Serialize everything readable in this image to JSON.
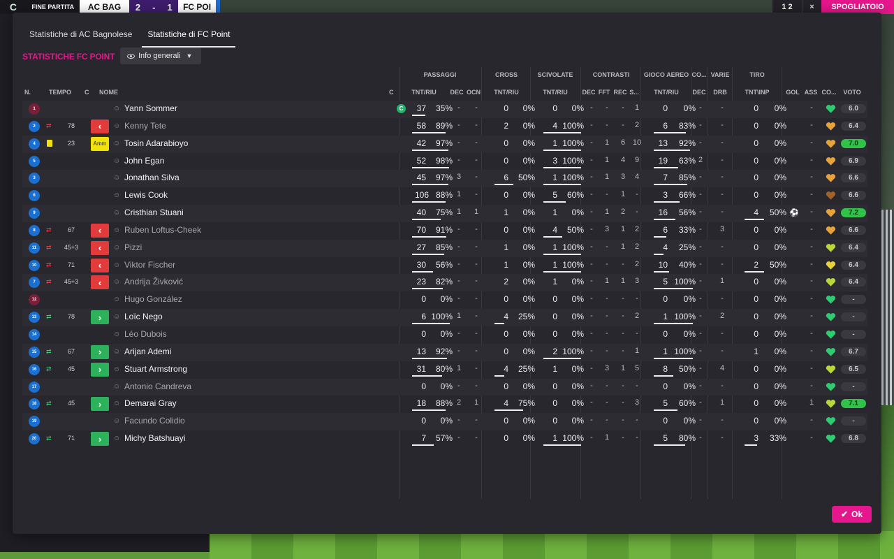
{
  "scorebar": {
    "status": "FINE PARTITA",
    "home": "AC BAG",
    "score_home": "2",
    "score_sep": "-",
    "score_away": "1",
    "away": "FC POI",
    "logo": "C"
  },
  "top_right": {
    "counter": "1 2",
    "close": "×",
    "button": "SPOGLIATOIO"
  },
  "tabs": [
    "Statistiche di AC Bagnolese",
    "Statistiche di FC Point"
  ],
  "section_title": "STATISTICHE FC POINT",
  "dropdown": "Info generali",
  "groups": {
    "passaggi": "PASSAGGI",
    "cross": "CROSS",
    "scivolate": "SCIVOLATE",
    "contrasti": "CONTRASTI",
    "gioco_aereo": "GIOCO AEREO",
    "co": "CO...",
    "varie": "VARIE",
    "tiro": "TIRO"
  },
  "columns": {
    "n": "N.",
    "tempo": "TEMPO",
    "c": "C",
    "nome": "NOME",
    "c2": "C",
    "pass_tnt": "TNT/RIU",
    "pass_dec": "DEC",
    "pass_ocn": "OCN",
    "cross_tnt": "TNT/RIU",
    "sciv_tnt": "TNT/RIU",
    "con_dec": "DEC",
    "con_fft": "FFT",
    "con_rec": "REC",
    "con_s": "S...",
    "aereo_tnt": "TNT/RIU",
    "co_dec": "DEC",
    "varie_drb": "DRB",
    "tiro_tnt": "TNT\\INP",
    "gol": "GOL",
    "ass": "ASS",
    "cond": "CO...",
    "voto": "VOTO"
  },
  "players": [
    {
      "num": "1",
      "gk": true,
      "ev": "",
      "time": "",
      "cap": "",
      "name": "Yann Sommer",
      "dim": false,
      "captain": true,
      "p": [
        "37",
        "35%"
      ],
      "pd": "-",
      "po": "-",
      "cr": [
        "0",
        "0%"
      ],
      "sc": [
        "0",
        "0%"
      ],
      "cd": "-",
      "cf": "-",
      "crc": "-",
      "cs": "1",
      "ae": [
        "0",
        "0%"
      ],
      "cod": "-",
      "drb": "-",
      "ti": [
        "0",
        "0%"
      ],
      "gol": "",
      "ass": "-",
      "heart": "#2ecc71",
      "voto": "6.0",
      "vg": false,
      "pb": 0.35,
      "crb": 0,
      "scb": 0,
      "aeb": 0,
      "tib": 0
    },
    {
      "num": "2",
      "gk": false,
      "ev": "out",
      "time": "78",
      "cap": "r",
      "name": "Kenny Tete",
      "dim": true,
      "captain": false,
      "p": [
        "58",
        "89%"
      ],
      "pd": "-",
      "po": "-",
      "cr": [
        "2",
        "0%"
      ],
      "sc": [
        "4",
        "100%"
      ],
      "cd": "-",
      "cf": "-",
      "crc": "-",
      "cs": "2",
      "ae": [
        "6",
        "83%"
      ],
      "cod": "-",
      "drb": "-",
      "ti": [
        "0",
        "0%"
      ],
      "gol": "",
      "ass": "-",
      "heart": "#e8a23a",
      "voto": "6.4",
      "vg": false,
      "pb": 0.89,
      "crb": 0,
      "scb": 1,
      "aeb": 0.83,
      "tib": 0
    },
    {
      "num": "4",
      "gk": false,
      "ev": "yc",
      "time": "23",
      "cap": "y",
      "name": "Tosin Adarabioyo",
      "dim": false,
      "captain": false,
      "p": [
        "42",
        "97%"
      ],
      "pd": "-",
      "po": "-",
      "cr": [
        "0",
        "0%"
      ],
      "sc": [
        "1",
        "100%"
      ],
      "cd": "-",
      "cf": "1",
      "crc": "6",
      "cs": "10",
      "ae": [
        "13",
        "92%"
      ],
      "cod": "-",
      "drb": "-",
      "ti": [
        "0",
        "0%"
      ],
      "gol": "",
      "ass": "-",
      "heart": "#e8a23a",
      "voto": "7.0",
      "vg": true,
      "pb": 0.97,
      "crb": 0,
      "scb": 1,
      "aeb": 0.92,
      "tib": 0
    },
    {
      "num": "5",
      "gk": false,
      "ev": "",
      "time": "",
      "cap": "",
      "name": "John Egan",
      "dim": false,
      "captain": false,
      "p": [
        "52",
        "98%"
      ],
      "pd": "-",
      "po": "-",
      "cr": [
        "0",
        "0%"
      ],
      "sc": [
        "3",
        "100%"
      ],
      "cd": "-",
      "cf": "1",
      "crc": "4",
      "cs": "9",
      "ae": [
        "19",
        "63%"
      ],
      "cod": "2",
      "drb": "-",
      "ti": [
        "0",
        "0%"
      ],
      "gol": "",
      "ass": "-",
      "heart": "#e8a23a",
      "voto": "6.9",
      "vg": false,
      "pb": 0.98,
      "crb": 0,
      "scb": 1,
      "aeb": 0.63,
      "tib": 0
    },
    {
      "num": "3",
      "gk": false,
      "ev": "",
      "time": "",
      "cap": "",
      "name": "Jonathan Silva",
      "dim": false,
      "captain": false,
      "p": [
        "45",
        "97%"
      ],
      "pd": "3",
      "po": "-",
      "cr": [
        "6",
        "50%"
      ],
      "sc": [
        "1",
        "100%"
      ],
      "cd": "-",
      "cf": "1",
      "crc": "3",
      "cs": "4",
      "ae": [
        "7",
        "85%"
      ],
      "cod": "-",
      "drb": "-",
      "ti": [
        "0",
        "0%"
      ],
      "gol": "",
      "ass": "-",
      "heart": "#e8a23a",
      "voto": "6.6",
      "vg": false,
      "pb": 0.97,
      "crb": 0.5,
      "scb": 1,
      "aeb": 0.85,
      "tib": 0
    },
    {
      "num": "6",
      "gk": false,
      "ev": "",
      "time": "",
      "cap": "",
      "name": "Lewis Cook",
      "dim": false,
      "captain": false,
      "p": [
        "106",
        "88%"
      ],
      "pd": "1",
      "po": "-",
      "cr": [
        "0",
        "0%"
      ],
      "sc": [
        "5",
        "60%"
      ],
      "cd": "-",
      "cf": "-",
      "crc": "1",
      "cs": "-",
      "ae": [
        "3",
        "66%"
      ],
      "cod": "-",
      "drb": "-",
      "ti": [
        "0",
        "0%"
      ],
      "gol": "",
      "ass": "-",
      "heart": "#a0622a",
      "voto": "6.6",
      "vg": false,
      "pb": 0.88,
      "crb": 0,
      "scb": 0.6,
      "aeb": 0.66,
      "tib": 0
    },
    {
      "num": "9",
      "gk": false,
      "ev": "",
      "time": "",
      "cap": "",
      "name": "Cristhian Stuani",
      "dim": false,
      "captain": false,
      "p": [
        "40",
        "75%"
      ],
      "pd": "1",
      "po": "1",
      "cr": [
        "1",
        "0%"
      ],
      "sc": [
        "1",
        "0%"
      ],
      "cd": "-",
      "cf": "1",
      "crc": "2",
      "cs": "-",
      "ae": [
        "16",
        "56%"
      ],
      "cod": "-",
      "drb": "-",
      "ti": [
        "4",
        "50%"
      ],
      "gol": "⚽",
      "ass": "-",
      "heart": "#e8a23a",
      "voto": "7.2",
      "vg": true,
      "pb": 0.75,
      "crb": 0,
      "scb": 0,
      "aeb": 0.56,
      "tib": 0.5
    },
    {
      "num": "8",
      "gk": false,
      "ev": "out",
      "time": "67",
      "cap": "r",
      "name": "Ruben Loftus-Cheek",
      "dim": true,
      "captain": false,
      "p": [
        "70",
        "91%"
      ],
      "pd": "-",
      "po": "-",
      "cr": [
        "0",
        "0%"
      ],
      "sc": [
        "4",
        "50%"
      ],
      "cd": "-",
      "cf": "3",
      "crc": "1",
      "cs": "2",
      "ae": [
        "6",
        "33%"
      ],
      "cod": "-",
      "drb": "3",
      "ti": [
        "0",
        "0%"
      ],
      "gol": "",
      "ass": "-",
      "heart": "#e8a23a",
      "voto": "6.6",
      "vg": false,
      "pb": 0.91,
      "crb": 0,
      "scb": 0.5,
      "aeb": 0.33,
      "tib": 0
    },
    {
      "num": "11",
      "gk": false,
      "ev": "out",
      "time": "45+3",
      "cap": "r",
      "name": "Pizzi",
      "dim": true,
      "captain": false,
      "p": [
        "27",
        "85%"
      ],
      "pd": "-",
      "po": "-",
      "cr": [
        "1",
        "0%"
      ],
      "sc": [
        "1",
        "100%"
      ],
      "cd": "-",
      "cf": "-",
      "crc": "1",
      "cs": "2",
      "ae": [
        "4",
        "25%"
      ],
      "cod": "-",
      "drb": "-",
      "ti": [
        "0",
        "0%"
      ],
      "gol": "",
      "ass": "-",
      "heart": "#b8d83a",
      "voto": "6.4",
      "vg": false,
      "pb": 0.85,
      "crb": 0,
      "scb": 1,
      "aeb": 0.25,
      "tib": 0
    },
    {
      "num": "10",
      "gk": false,
      "ev": "out",
      "time": "71",
      "cap": "r",
      "name": "Viktor Fischer",
      "dim": true,
      "captain": false,
      "p": [
        "30",
        "56%"
      ],
      "pd": "-",
      "po": "-",
      "cr": [
        "1",
        "0%"
      ],
      "sc": [
        "1",
        "100%"
      ],
      "cd": "-",
      "cf": "-",
      "crc": "-",
      "cs": "2",
      "ae": [
        "10",
        "40%"
      ],
      "cod": "-",
      "drb": "-",
      "ti": [
        "2",
        "50%"
      ],
      "gol": "",
      "ass": "-",
      "heart": "#e8d23a",
      "voto": "6.4",
      "vg": false,
      "pb": 0.56,
      "crb": 0,
      "scb": 1,
      "aeb": 0.4,
      "tib": 0.5
    },
    {
      "num": "7",
      "gk": false,
      "ev": "out",
      "time": "45+3",
      "cap": "r",
      "name": "Andrija Živković",
      "dim": true,
      "captain": false,
      "p": [
        "23",
        "82%"
      ],
      "pd": "-",
      "po": "-",
      "cr": [
        "2",
        "0%"
      ],
      "sc": [
        "1",
        "0%"
      ],
      "cd": "-",
      "cf": "1",
      "crc": "1",
      "cs": "3",
      "ae": [
        "5",
        "100%"
      ],
      "cod": "-",
      "drb": "1",
      "ti": [
        "0",
        "0%"
      ],
      "gol": "",
      "ass": "-",
      "heart": "#b8d83a",
      "voto": "6.4",
      "vg": false,
      "pb": 0.82,
      "crb": 0,
      "scb": 0,
      "aeb": 1,
      "tib": 0
    },
    {
      "num": "12",
      "gk": true,
      "ev": "",
      "time": "",
      "cap": "",
      "name": "Hugo González",
      "dim": true,
      "captain": false,
      "p": [
        "0",
        "0%"
      ],
      "pd": "-",
      "po": "-",
      "cr": [
        "0",
        "0%"
      ],
      "sc": [
        "0",
        "0%"
      ],
      "cd": "-",
      "cf": "-",
      "crc": "-",
      "cs": "-",
      "ae": [
        "0",
        "0%"
      ],
      "cod": "-",
      "drb": "-",
      "ti": [
        "0",
        "0%"
      ],
      "gol": "",
      "ass": "-",
      "heart": "#2ecc71",
      "voto": "-",
      "vg": false,
      "pb": 0,
      "crb": 0,
      "scb": 0,
      "aeb": 0,
      "tib": 0
    },
    {
      "num": "13",
      "gk": false,
      "ev": "in",
      "time": "78",
      "cap": "g",
      "name": "Loïc Nego",
      "dim": false,
      "captain": false,
      "p": [
        "6",
        "100%"
      ],
      "pd": "1",
      "po": "-",
      "cr": [
        "4",
        "25%"
      ],
      "sc": [
        "0",
        "0%"
      ],
      "cd": "-",
      "cf": "-",
      "crc": "-",
      "cs": "2",
      "ae": [
        "1",
        "100%"
      ],
      "cod": "-",
      "drb": "2",
      "ti": [
        "0",
        "0%"
      ],
      "gol": "",
      "ass": "-",
      "heart": "#2ecc71",
      "voto": "-",
      "vg": false,
      "pb": 1,
      "crb": 0.25,
      "scb": 0,
      "aeb": 1,
      "tib": 0
    },
    {
      "num": "14",
      "gk": false,
      "ev": "",
      "time": "",
      "cap": "",
      "name": "Léo Dubois",
      "dim": true,
      "captain": false,
      "p": [
        "0",
        "0%"
      ],
      "pd": "-",
      "po": "-",
      "cr": [
        "0",
        "0%"
      ],
      "sc": [
        "0",
        "0%"
      ],
      "cd": "-",
      "cf": "-",
      "crc": "-",
      "cs": "-",
      "ae": [
        "0",
        "0%"
      ],
      "cod": "-",
      "drb": "-",
      "ti": [
        "0",
        "0%"
      ],
      "gol": "",
      "ass": "-",
      "heart": "#2ecc71",
      "voto": "-",
      "vg": false,
      "pb": 0,
      "crb": 0,
      "scb": 0,
      "aeb": 0,
      "tib": 0
    },
    {
      "num": "15",
      "gk": false,
      "ev": "in",
      "time": "67",
      "cap": "g",
      "name": "Arijan Ademi",
      "dim": false,
      "captain": false,
      "p": [
        "13",
        "92%"
      ],
      "pd": "-",
      "po": "-",
      "cr": [
        "0",
        "0%"
      ],
      "sc": [
        "2",
        "100%"
      ],
      "cd": "-",
      "cf": "-",
      "crc": "-",
      "cs": "1",
      "ae": [
        "1",
        "100%"
      ],
      "cod": "-",
      "drb": "-",
      "ti": [
        "1",
        "0%"
      ],
      "gol": "",
      "ass": "-",
      "heart": "#2ecc71",
      "voto": "6.7",
      "vg": false,
      "pb": 0.92,
      "crb": 0,
      "scb": 1,
      "aeb": 1,
      "tib": 0
    },
    {
      "num": "16",
      "gk": false,
      "ev": "in",
      "time": "45",
      "cap": "g",
      "name": "Stuart Armstrong",
      "dim": false,
      "captain": false,
      "p": [
        "31",
        "80%"
      ],
      "pd": "1",
      "po": "-",
      "cr": [
        "4",
        "25%"
      ],
      "sc": [
        "1",
        "0%"
      ],
      "cd": "-",
      "cf": "3",
      "crc": "1",
      "cs": "5",
      "ae": [
        "8",
        "50%"
      ],
      "cod": "-",
      "drb": "4",
      "ti": [
        "0",
        "0%"
      ],
      "gol": "",
      "ass": "-",
      "heart": "#b8d83a",
      "voto": "6.5",
      "vg": false,
      "pb": 0.8,
      "crb": 0.25,
      "scb": 0,
      "aeb": 0.5,
      "tib": 0
    },
    {
      "num": "17",
      "gk": false,
      "ev": "",
      "time": "",
      "cap": "",
      "name": "Antonio Candreva",
      "dim": true,
      "captain": false,
      "p": [
        "0",
        "0%"
      ],
      "pd": "-",
      "po": "-",
      "cr": [
        "0",
        "0%"
      ],
      "sc": [
        "0",
        "0%"
      ],
      "cd": "-",
      "cf": "-",
      "crc": "-",
      "cs": "-",
      "ae": [
        "0",
        "0%"
      ],
      "cod": "-",
      "drb": "-",
      "ti": [
        "0",
        "0%"
      ],
      "gol": "",
      "ass": "-",
      "heart": "#2ecc71",
      "voto": "-",
      "vg": false,
      "pb": 0,
      "crb": 0,
      "scb": 0,
      "aeb": 0,
      "tib": 0
    },
    {
      "num": "18",
      "gk": false,
      "ev": "in",
      "time": "45",
      "cap": "g",
      "name": "Demarai Gray",
      "dim": false,
      "captain": false,
      "p": [
        "18",
        "88%"
      ],
      "pd": "2",
      "po": "1",
      "cr": [
        "4",
        "75%"
      ],
      "sc": [
        "0",
        "0%"
      ],
      "cd": "-",
      "cf": "-",
      "crc": "-",
      "cs": "3",
      "ae": [
        "5",
        "60%"
      ],
      "cod": "-",
      "drb": "1",
      "ti": [
        "0",
        "0%"
      ],
      "gol": "",
      "ass": "1",
      "heart": "#b8d83a",
      "voto": "7.1",
      "vg": true,
      "pb": 0.88,
      "crb": 0.75,
      "scb": 0,
      "aeb": 0.6,
      "tib": 0
    },
    {
      "num": "19",
      "gk": false,
      "ev": "",
      "time": "",
      "cap": "",
      "name": "Facundo Colidio",
      "dim": true,
      "captain": false,
      "p": [
        "0",
        "0%"
      ],
      "pd": "-",
      "po": "-",
      "cr": [
        "0",
        "0%"
      ],
      "sc": [
        "0",
        "0%"
      ],
      "cd": "-",
      "cf": "-",
      "crc": "-",
      "cs": "-",
      "ae": [
        "0",
        "0%"
      ],
      "cod": "-",
      "drb": "-",
      "ti": [
        "0",
        "0%"
      ],
      "gol": "",
      "ass": "-",
      "heart": "#2ecc71",
      "voto": "-",
      "vg": false,
      "pb": 0,
      "crb": 0,
      "scb": 0,
      "aeb": 0,
      "tib": 0
    },
    {
      "num": "20",
      "gk": false,
      "ev": "in",
      "time": "71",
      "cap": "g",
      "name": "Michy Batshuayi",
      "dim": false,
      "captain": false,
      "p": [
        "7",
        "57%"
      ],
      "pd": "-",
      "po": "-",
      "cr": [
        "0",
        "0%"
      ],
      "sc": [
        "1",
        "100%"
      ],
      "cd": "-",
      "cf": "1",
      "crc": "-",
      "cs": "-",
      "ae": [
        "5",
        "80%"
      ],
      "cod": "-",
      "drb": "-",
      "ti": [
        "3",
        "33%"
      ],
      "gol": "",
      "ass": "-",
      "heart": "#2ecc71",
      "voto": "6.8",
      "vg": false,
      "pb": 0.57,
      "crb": 0,
      "scb": 1,
      "aeb": 0.8,
      "tib": 0.33
    }
  ],
  "cap_labels": {
    "yellow": "Amm",
    "captain_badge": "C"
  },
  "ok_button": "Ok"
}
